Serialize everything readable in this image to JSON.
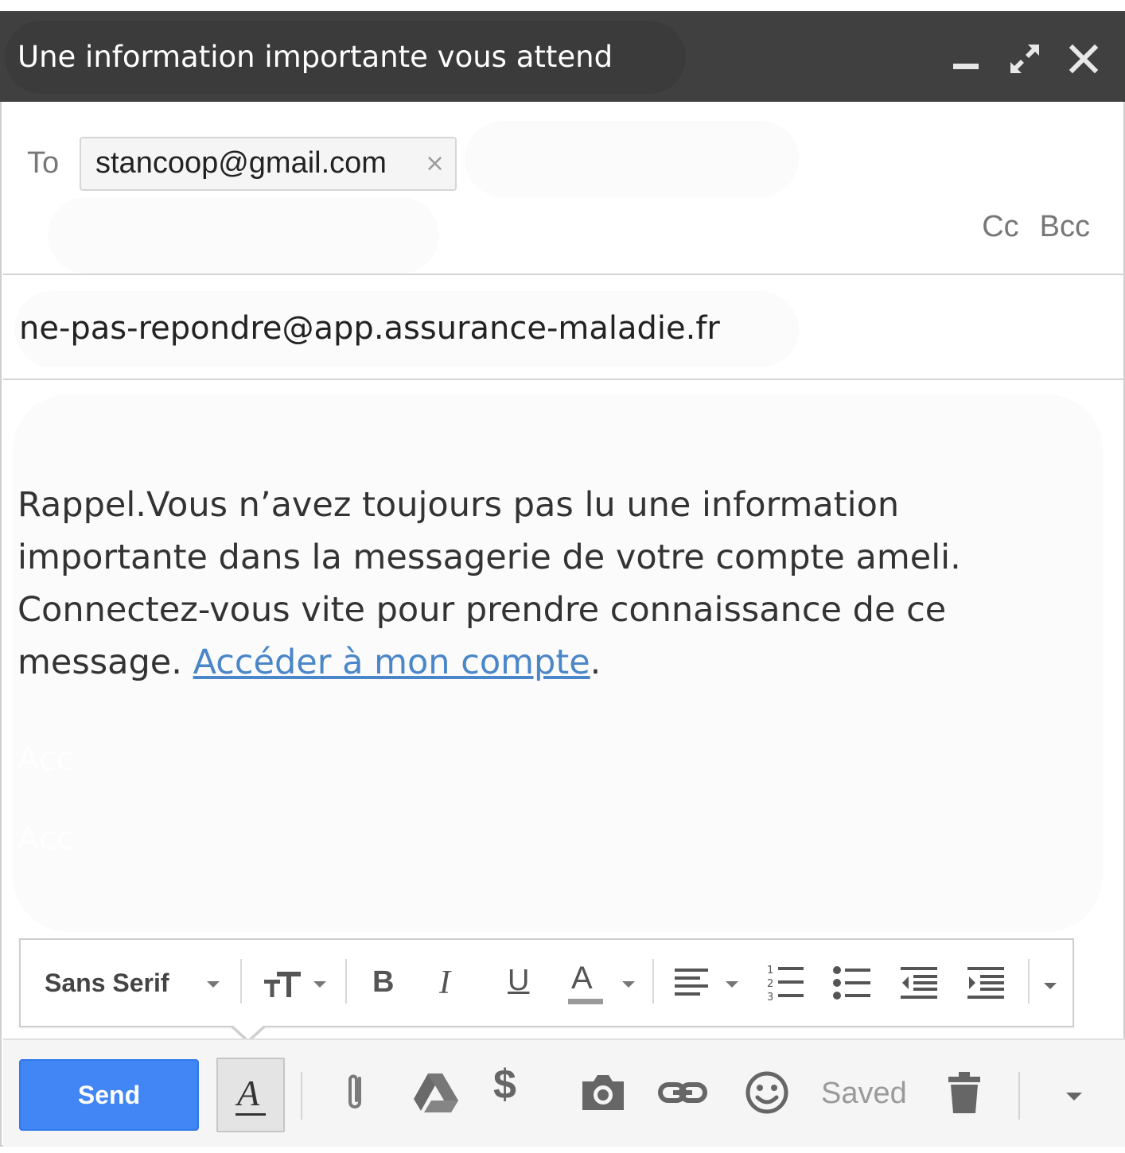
{
  "window": {
    "title": "Une information importante vous attend"
  },
  "recipients": {
    "to_label": "To",
    "to_chip": "stancoop@gmail.com",
    "chip_remove": "×",
    "cc_label": "Cc",
    "bcc_label": "Bcc"
  },
  "subject": {
    "value": "ne-pas-repondre@app.assurance-maladie.fr"
  },
  "message": {
    "line1": "Rappel.Vous n’avez toujours pas lu une information",
    "line2": "importante dans la messagerie de votre compte ameli.",
    "line3": "Connectez-vous vite pour prendre connaissance de ce",
    "line4_prefix": "message. ",
    "link_text": "Accéder à mon compte",
    "line4_suffix": ".",
    "ghost1": "Acc",
    "ghost2": "Acc"
  },
  "format_toolbar": {
    "font_name": "Sans Serif",
    "bold": "B",
    "italic": "I",
    "underline": "U",
    "text_color": "A"
  },
  "bottom_bar": {
    "send_label": "Send",
    "formatting_toggle": "A",
    "money_icon": "$",
    "status": "Saved"
  },
  "colors": {
    "titlebar": "#404040",
    "send": "#4285f4",
    "link": "#4a86c8"
  }
}
